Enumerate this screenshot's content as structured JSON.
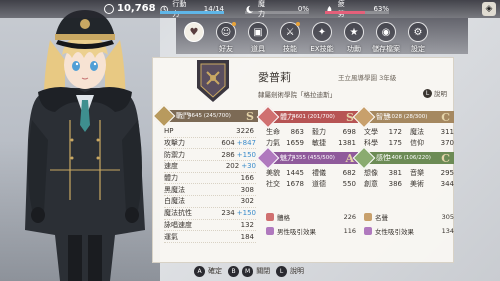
{
  "topbar": {
    "coins": "10,768",
    "action_label": "行動力",
    "action_value": "14",
    "action_max": "14",
    "action_fill": 1.0,
    "magic_label": "魔力",
    "magic_value": "0%",
    "magic_fill": 0.0,
    "fatigue_label": "疲勞",
    "fatigue_value": "63%",
    "fatigue_fill": 0.63,
    "right_icon": "◈"
  },
  "nav": [
    {
      "label": "",
      "icon": "♥",
      "active": true
    },
    {
      "label": "好友",
      "icon": "☺",
      "active": false,
      "dot": true
    },
    {
      "label": "道具",
      "icon": "▣",
      "active": false
    },
    {
      "label": "技能",
      "icon": "⚔",
      "active": false,
      "dot": true
    },
    {
      "label": "EX技能",
      "icon": "✦",
      "active": false
    },
    {
      "label": "功勳",
      "icon": "★",
      "active": false
    },
    {
      "label": "儲存檔案",
      "icon": "◉",
      "active": false
    },
    {
      "label": "設定",
      "icon": "⚙",
      "active": false
    }
  ],
  "character": {
    "name": "愛普莉",
    "school": "王立風導學園 3年級",
    "club": "隸屬劍術學院「格拉迪斯」",
    "explain_key": "L",
    "explain_label": "說明"
  },
  "combat": {
    "title": "戰鬥",
    "sub": "4645 (245/700)",
    "grade": "S",
    "rows": [
      {
        "label": "HP",
        "value": "3226",
        "bonus": ""
      },
      {
        "label": "攻擊力",
        "value": "604",
        "bonus": "+847"
      },
      {
        "label": "防禦力",
        "value": "286",
        "bonus": "+150"
      },
      {
        "label": "速度",
        "value": "202",
        "bonus": "+30"
      },
      {
        "label": "體力",
        "value": "166",
        "bonus": ""
      },
      {
        "label": "黑魔法",
        "value": "308",
        "bonus": ""
      },
      {
        "label": "白魔法",
        "value": "302",
        "bonus": ""
      },
      {
        "label": "魔法抗性",
        "value": "234",
        "bonus": "+150"
      },
      {
        "label": "詠唱速度",
        "value": "132",
        "bonus": ""
      },
      {
        "label": "運氣",
        "value": "184",
        "bonus": ""
      }
    ]
  },
  "physical": {
    "title": "體力",
    "sub": "4601 (201/700)",
    "grade": "S",
    "rows": [
      [
        "生命",
        "863",
        "毅力",
        "698"
      ],
      [
        "力氣",
        "1659",
        "敏捷",
        "1381"
      ]
    ]
  },
  "intellect": {
    "title": "智慧",
    "sub": "1028 (28/300)",
    "grade": "C",
    "rows": [
      [
        "文學",
        "172",
        "魔法",
        "311"
      ],
      [
        "科學",
        "175",
        "信仰",
        "370"
      ]
    ]
  },
  "charm": {
    "title": "魅力",
    "sub": "4355 (455/500)",
    "grade": "A",
    "rows": [
      [
        "美貌",
        "1445",
        "禮儀",
        "682"
      ],
      [
        "社交",
        "1678",
        "道德",
        "550"
      ]
    ]
  },
  "voice": {
    "title": "感性",
    "sub": "1406 (106/220)",
    "grade": "C",
    "rows": [
      [
        "想像",
        "381",
        "音樂",
        "295"
      ],
      [
        "創意",
        "386",
        "美術",
        "344"
      ]
    ]
  },
  "extras": [
    {
      "label": "體格",
      "value": "226",
      "color": "#d07070"
    },
    {
      "label": "名聲",
      "value": "305",
      "color": "#c8a06c"
    },
    {
      "label": "男性吸引效果",
      "value": "116",
      "color": "#b079be"
    },
    {
      "label": "女性吸引效果",
      "value": "134",
      "color": "#b079be"
    }
  ],
  "bottom": {
    "confirm_key": "A",
    "confirm_label": "確定",
    "close_key1": "B",
    "close_key2": "M",
    "close_label": "關閉",
    "help_key": "L",
    "help_label": "說明"
  },
  "colors": {
    "accent": "#3a8ccb",
    "combat": "#7c6a55",
    "physical": "#b75454",
    "intellect": "#a58860",
    "charm": "#8f5a9b",
    "voice": "#6c8b55"
  }
}
